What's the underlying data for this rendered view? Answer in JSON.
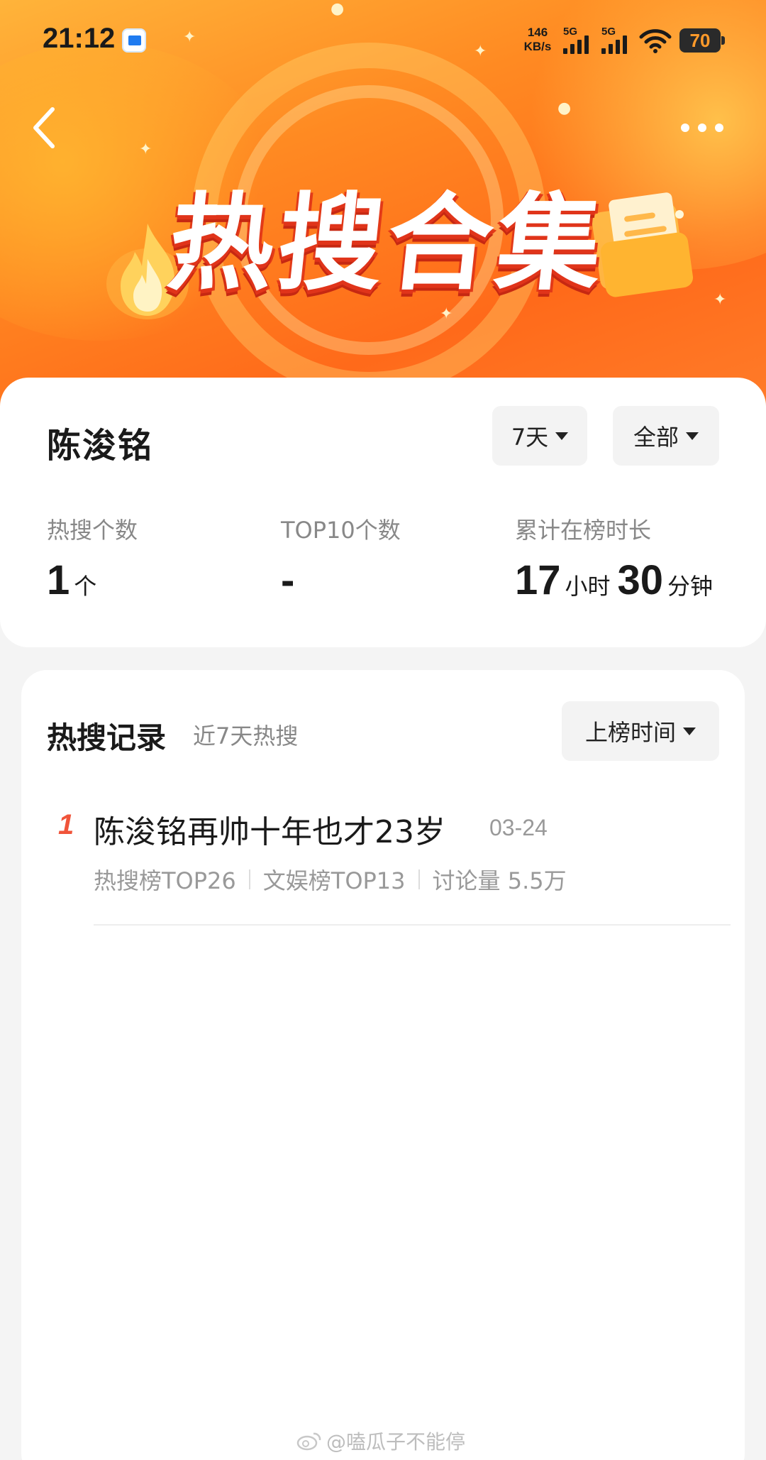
{
  "status_bar": {
    "time": "21:12",
    "net_speed_value": "146",
    "net_speed_unit": "KB/s",
    "sim1_label": "5G",
    "sim2_label": "5G",
    "battery": "70"
  },
  "header": {
    "title": "热搜合集"
  },
  "profile": {
    "name": "陈浚铭",
    "range_dropdown": "7天",
    "filter_dropdown": "全部"
  },
  "stats": [
    {
      "label": "热搜个数",
      "value": "1",
      "unit": "个"
    },
    {
      "label": "TOP10个数",
      "value": "-"
    },
    {
      "label": "累计在榜时长",
      "hours": "17",
      "hours_unit": "小时",
      "minutes": "30",
      "minutes_unit": "分钟"
    }
  ],
  "records": {
    "title": "热搜记录",
    "subtitle": "近7天热搜",
    "sort_dropdown": "上榜时间",
    "items": [
      {
        "rank": "1",
        "title": "陈浚铭再帅十年也才23岁",
        "date": "03-24",
        "meta": [
          "热搜榜TOP26",
          "文娱榜TOP13",
          "讨论量 5.5万"
        ]
      }
    ]
  },
  "watermark": "@嗑瓜子不能停",
  "colors": {
    "hero_orange": "#ff7a22",
    "rank_red": "#f0543a",
    "name_highlight": "#ffd9a8"
  }
}
